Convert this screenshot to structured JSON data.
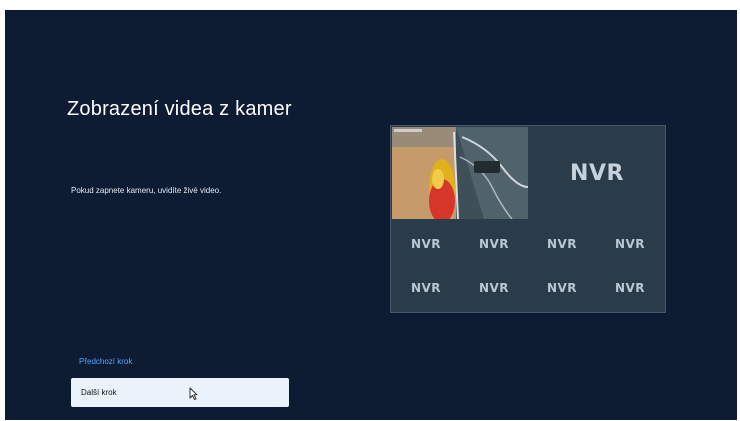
{
  "page": {
    "title": "Zobrazení videa z kamer",
    "description": "Pokud zapnete kameru, uvidíte živé video."
  },
  "nav": {
    "prev_label": "Předchozí krok",
    "next_label": "Další krok"
  },
  "camera_grid": {
    "placeholder": "NVR",
    "main_placeholder": "NVR",
    "live_tile_icon": "camera-feed-thumbnail"
  },
  "colors": {
    "background": "#0d1b33",
    "panel": "#2a3c4a",
    "link": "#5aa4ff",
    "button": "#eaf3fc"
  }
}
